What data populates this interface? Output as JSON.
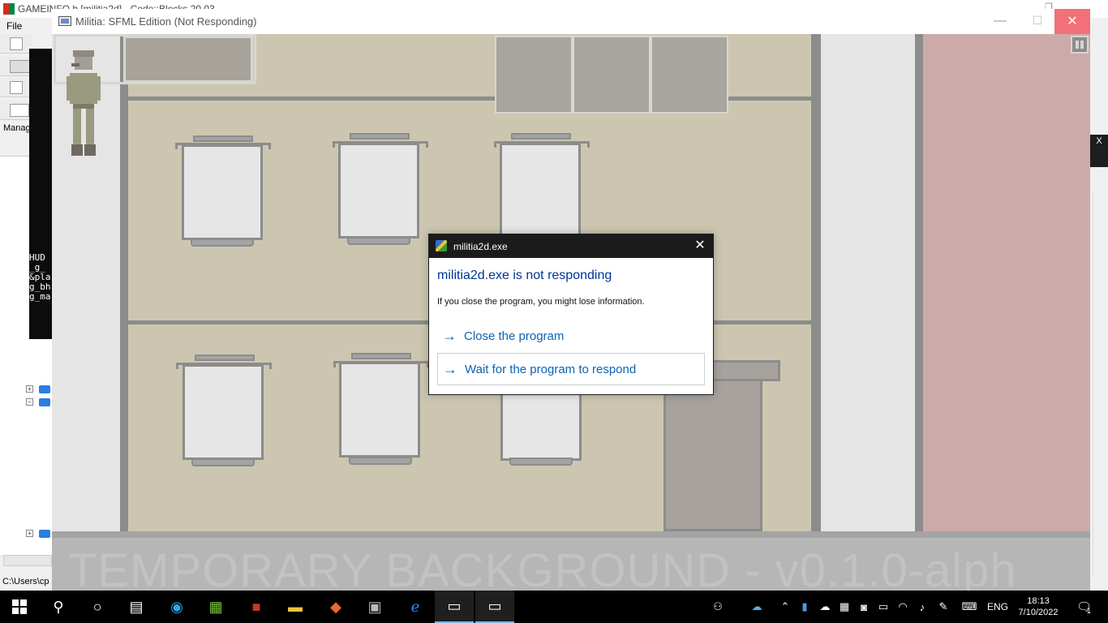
{
  "ide": {
    "title": "GAMEINFO.h [militia2d] - Code::Blocks 20.03",
    "menu_file": "File",
    "management_label": "Manag",
    "console_lines": [
      "HUD",
      "_g_",
      "&pla",
      "g_bh",
      "g_ma"
    ],
    "status_text": "C:\\Users\\cp"
  },
  "game_window": {
    "title": "Militia: SFML Edition (Not Responding)",
    "watermark": "TEMPORARY BACKGROUND - v0.1.0-alph"
  },
  "dialog": {
    "title": "militia2d.exe",
    "heading": "militia2d.exe is not responding",
    "body": "If you close the program, you might lose information.",
    "option_close": "Close the program",
    "option_wait": "Wait for the program to respond",
    "accent_color": "#0a64b4",
    "heading_color": "#003399"
  },
  "taskbar": {
    "items": [
      "start-icon",
      "search-icon",
      "cortana-icon",
      "task-view-icon",
      "edge-icon",
      "notepad-icon",
      "winrar-icon",
      "file-explorer-icon",
      "git-icon",
      "photos-icon",
      "internet-explorer-icon",
      "game-window-icon",
      "militia-window-icon"
    ],
    "language": "ENG",
    "time": "18:13",
    "date": "7/10/2022",
    "notification_count": "1"
  }
}
